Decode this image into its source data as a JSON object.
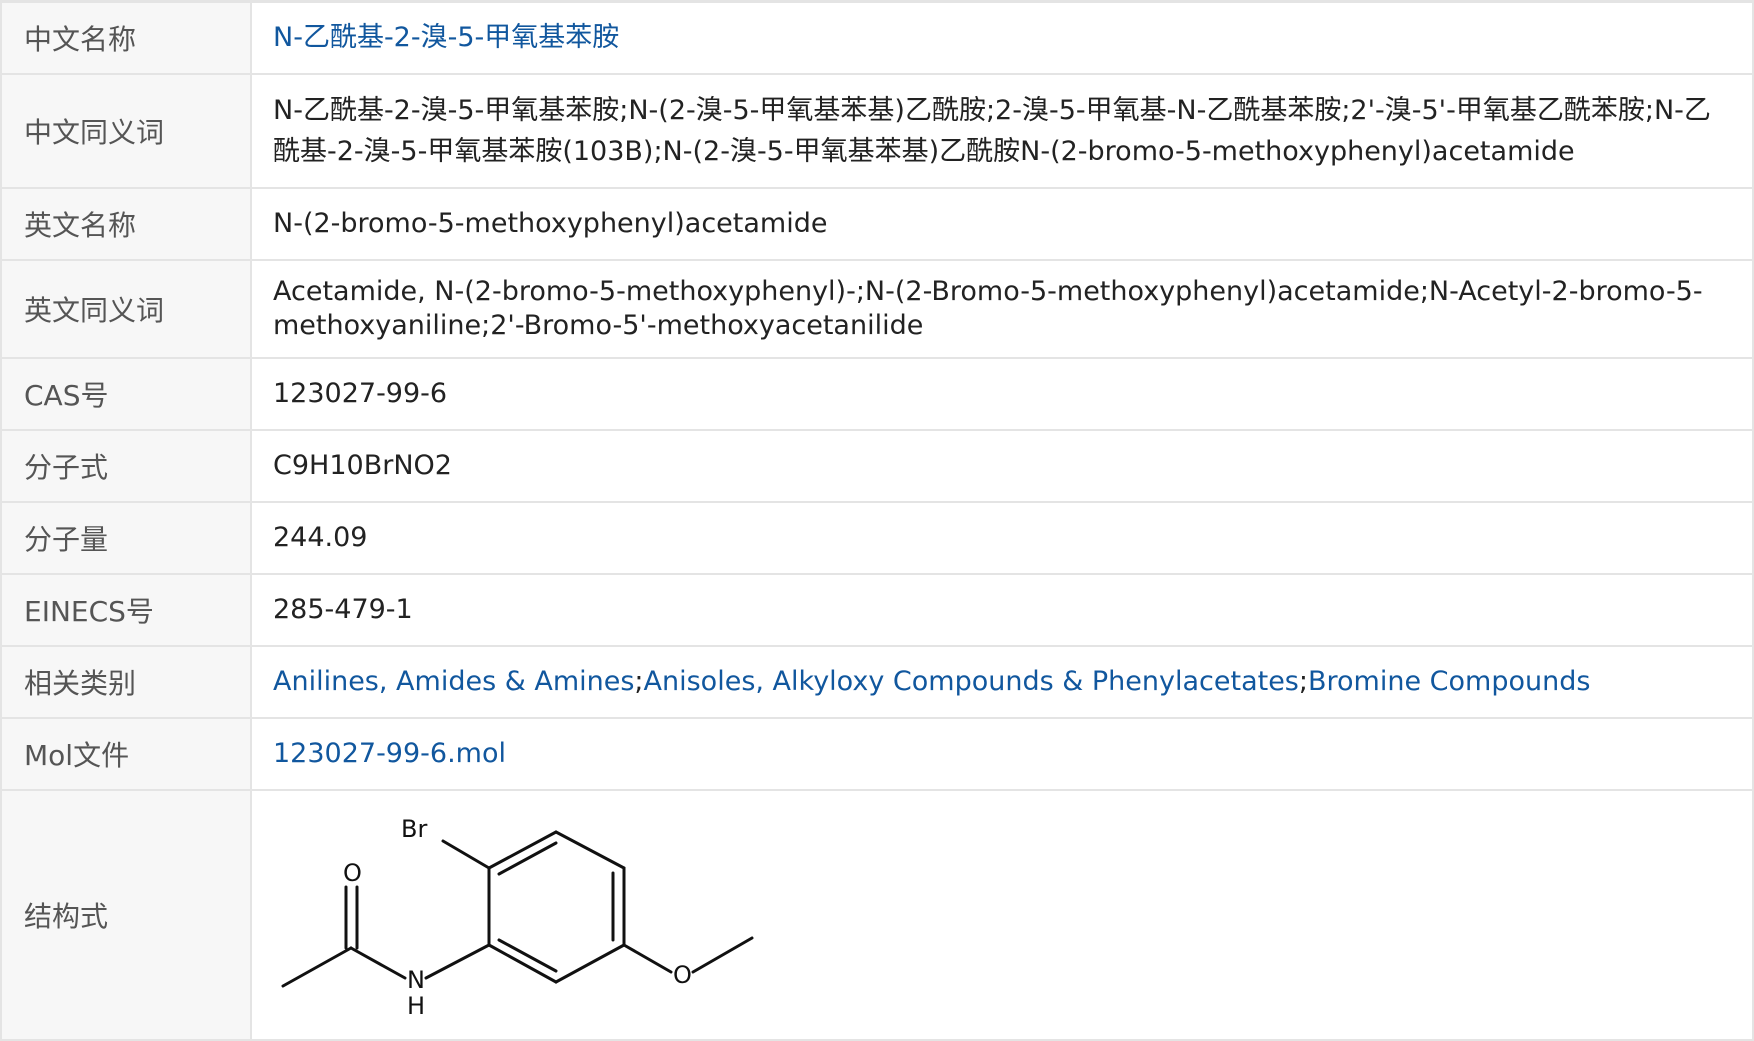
{
  "rows": {
    "cn_name": {
      "label": "中文名称",
      "value": "N-乙酰基-2-溴-5-甲氧基苯胺"
    },
    "cn_synonyms": {
      "label": "中文同义词",
      "value": "N-乙酰基-2-溴-5-甲氧基苯胺;N-(2-溴-5-甲氧基苯基)乙酰胺;2-溴-5-甲氧基-N-乙酰基苯胺;2'-溴-5'-甲氧基乙酰苯胺;N-乙酰基-2-溴-5-甲氧基苯胺(103B);N-(2-溴-5-甲氧基苯基)乙酰胺N-(2-bromo-5-methoxyphenyl)acetamide"
    },
    "en_name": {
      "label": "英文名称",
      "value": "N-(2-bromo-5-methoxyphenyl)acetamide"
    },
    "en_synonyms": {
      "label": "英文同义词",
      "value": "Acetamide, N-(2-bromo-5-methoxyphenyl)-;N-(2-Bromo-5-methoxyphenyl)acetamide;N-Acetyl-2-bromo-5-methoxyaniline;2'-Bromo-5'-methoxyacetanilide"
    },
    "cas": {
      "label": "CAS号",
      "value": "123027-99-6"
    },
    "formula": {
      "label": "分子式",
      "value": "C9H10BrNO2"
    },
    "mw": {
      "label": "分子量",
      "value": "244.09"
    },
    "einecs": {
      "label": "EINECS号",
      "value": "285-479-1"
    },
    "categories": {
      "label": "相关类别",
      "links": [
        "Anilines, Amides & Amines",
        "Anisoles, Alkyloxy Compounds & Phenylacetates",
        "Bromine Compounds"
      ],
      "separator": ";"
    },
    "mol_file": {
      "label": "Mol文件",
      "value": "123027-99-6.mol"
    },
    "structure": {
      "label": "结构式",
      "atoms": {
        "br": "Br",
        "o_carbonyl": "O",
        "n": "N",
        "h": "H",
        "o_ether": "O"
      }
    }
  },
  "colors": {
    "link": "#11579e",
    "label_bg": "#f7f7f7",
    "border": "#e4e4e4",
    "text": "#222222",
    "label_text": "#555555"
  }
}
